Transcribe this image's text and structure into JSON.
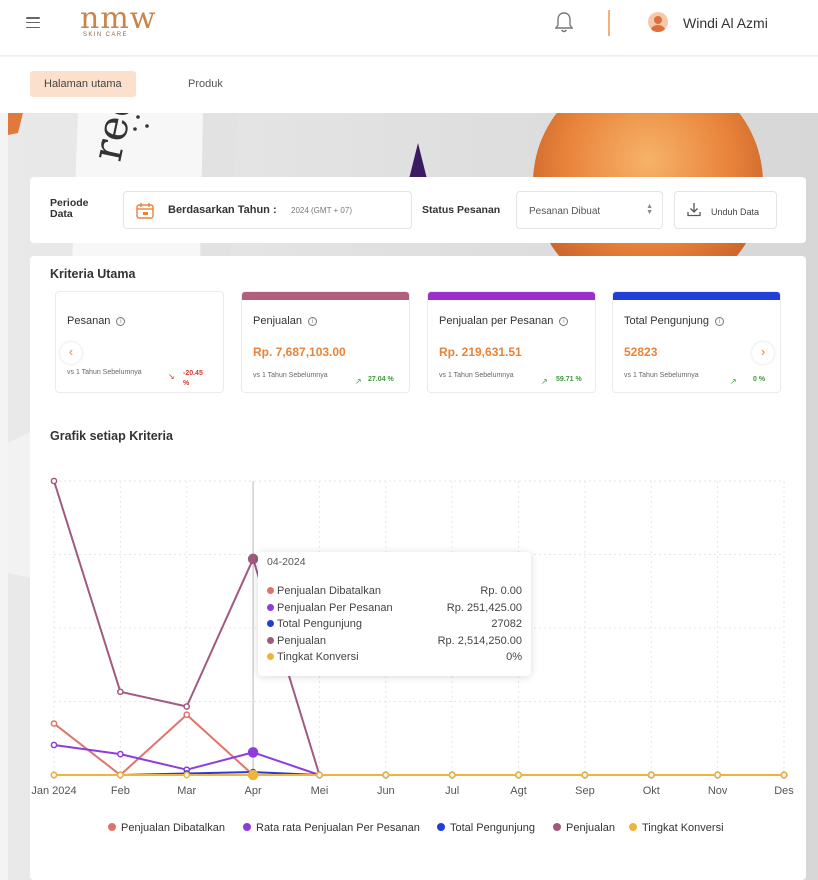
{
  "header": {
    "logo_text": "nmw",
    "logo_sub": "SKIN CARE",
    "user_name": "Windi Al Azmi",
    "icons": [
      "menu-icon",
      "bell-icon",
      "avatar-icon"
    ]
  },
  "tabs": [
    {
      "label": "Halaman utama",
      "active": true
    },
    {
      "label": "Produk",
      "active": false
    }
  ],
  "filters": {
    "period_label": "Periode Data",
    "period_title": "Berdasarkan Tahun :",
    "period_value": "2024 (GMT + 07)",
    "status_label": "Status Pesanan",
    "status_value": "Pesanan Dibuat",
    "download_label": "Unduh Data"
  },
  "criteria": {
    "title": "Kriteria Utama",
    "cards": [
      {
        "name": "Pesanan",
        "value": "",
        "vs": "vs 1 Tahun Sebelumnya",
        "change": "-20.45 %",
        "direction": "down",
        "color": ""
      },
      {
        "name": "Penjualan",
        "value": "Rp. 7,687,103.00",
        "vs": "vs 1 Tahun Sebelumnya",
        "change": "27.04 %",
        "direction": "up",
        "color": "#b0607c"
      },
      {
        "name": "Penjualan per Pesanan",
        "value": "Rp. 219,631.51",
        "vs": "vs 1 Tahun Sebelumnya",
        "change": "59.71 %",
        "direction": "up",
        "color": "#9b2fc9"
      },
      {
        "name": "Total Pengunjung",
        "value": "52823",
        "vs": "vs 1 Tahun Sebelumnya",
        "change": "0 %",
        "direction": "up",
        "color": "#1f3fd8"
      }
    ]
  },
  "chart_section_title": "Grafik setiap Kriteria",
  "tooltip": {
    "title": "04-2024",
    "rows": [
      {
        "label": "Penjualan Dibatalkan",
        "value": "Rp. 0.00",
        "color": "#e0746a"
      },
      {
        "label": "Penjualan Per Pesanan",
        "value": "Rp. 251,425.00",
        "color": "#8d3ddb"
      },
      {
        "label": "Total Pengunjung",
        "value": "27082",
        "color": "#1f3fd8"
      },
      {
        "label": "Penjualan",
        "value": "Rp. 2,514,250.00",
        "color": "#a05a80"
      },
      {
        "label": "Tingkat Konversi",
        "value": "0%",
        "color": "#f0b43c"
      }
    ]
  },
  "chart_data": {
    "type": "line",
    "categories": [
      "Jan 2024",
      "Feb",
      "Mar",
      "Apr",
      "Mei",
      "Jun",
      "Jul",
      "Agt",
      "Sep",
      "Okt",
      "Nov",
      "Des"
    ],
    "ylim": [
      0,
      1
    ],
    "grid": true,
    "legend_position": "bottom",
    "series": [
      {
        "name": "Penjualan Dibatalkan",
        "color": "#e0746a",
        "values": [
          0.175,
          0,
          0.205,
          0,
          0,
          0,
          0,
          0,
          0,
          0,
          0,
          0
        ]
      },
      {
        "name": "Rata rata Penjualan Per Pesanan",
        "color": "#8d3ddb",
        "values": [
          0.102,
          0.071,
          0.018,
          0.077,
          0,
          0,
          0,
          0,
          0,
          0,
          0,
          0
        ]
      },
      {
        "name": "Total Pengunjung",
        "color": "#1f3fd8",
        "values": [
          0,
          0,
          0.005,
          0.01,
          0,
          0,
          0,
          0,
          0,
          0,
          0,
          0
        ]
      },
      {
        "name": "Penjualan",
        "color": "#a05a80",
        "values": [
          1.0,
          0.283,
          0.233,
          0.735,
          0,
          0,
          0,
          0,
          0,
          0,
          0,
          0
        ]
      },
      {
        "name": "Tingkat Konversi",
        "color": "#f0b43c",
        "values": [
          0,
          0,
          0,
          0,
          0,
          0,
          0,
          0,
          0,
          0,
          0,
          0
        ]
      }
    ]
  }
}
